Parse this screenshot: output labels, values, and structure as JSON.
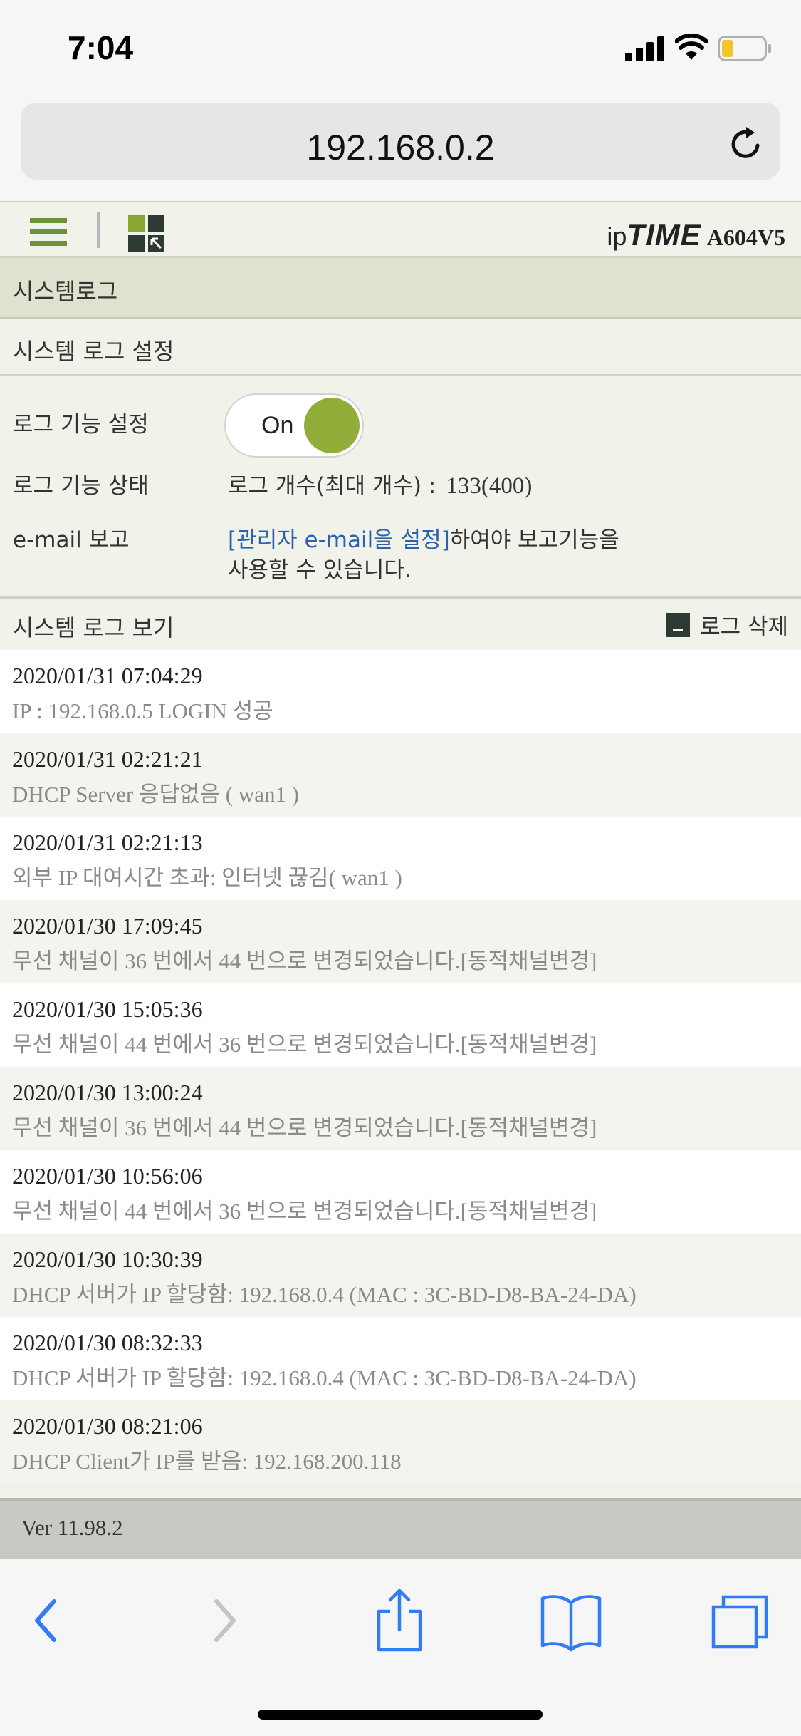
{
  "status_bar": {
    "time": "7:04"
  },
  "browser": {
    "url": "192.168.0.2"
  },
  "router": {
    "brand_ip": "ip",
    "brand_time": "TIME",
    "model": "A604V5",
    "section_title": "시스템로그",
    "settings_header": "시스템 로그 설정",
    "settings": {
      "log_function_label": "로그 기능 설정",
      "toggle_label": "On",
      "log_status_label": "로그 기능 상태",
      "log_count_label": "로그 개수(최대 개수) :",
      "log_count_value": "133(400)",
      "email_label": "e-mail 보고",
      "email_link": "[관리자 e-mail을 설정]",
      "email_text_after_link": "하여야 보고기능을",
      "email_text_line2": "사용할 수 있습니다."
    },
    "log_view_header": "시스템 로그 보기",
    "delete_label": "로그 삭제",
    "logs": [
      {
        "date": "2020/01/31 07:04:29",
        "message": "IP : 192.168.0.5 LOGIN 성공"
      },
      {
        "date": "2020/01/31 02:21:21",
        "message": "DHCP Server 응답없음 ( wan1 )"
      },
      {
        "date": "2020/01/31 02:21:13",
        "message": "외부 IP 대여시간 초과: 인터넷 끊김( wan1 )"
      },
      {
        "date": "2020/01/30 17:09:45",
        "message": "무선 채널이 36 번에서 44 번으로 변경되었습니다.[동적채널변경]"
      },
      {
        "date": "2020/01/30 15:05:36",
        "message": "무선 채널이 44 번에서 36 번으로 변경되었습니다.[동적채널변경]"
      },
      {
        "date": "2020/01/30 13:00:24",
        "message": "무선 채널이 36 번에서 44 번으로 변경되었습니다.[동적채널변경]"
      },
      {
        "date": "2020/01/30 10:56:06",
        "message": "무선 채널이 44 번에서 36 번으로 변경되었습니다.[동적채널변경]"
      },
      {
        "date": "2020/01/30 10:30:39",
        "message": "DHCP 서버가 IP 할당함: 192.168.0.4 (MAC : 3C-BD-D8-BA-24-DA)"
      },
      {
        "date": "2020/01/30 08:32:33",
        "message": "DHCP 서버가 IP 할당함: 192.168.0.4 (MAC : 3C-BD-D8-BA-24-DA)"
      },
      {
        "date": "2020/01/30 08:21:06",
        "message": "DHCP Client가 IP를 받음: 192.168.200.118"
      }
    ],
    "version": "Ver 11.98.2"
  },
  "icons": {
    "status": [
      "signal-icon",
      "wifi-icon",
      "battery-icon"
    ],
    "header": [
      "menu-icon",
      "apps-icon"
    ],
    "toolbar": [
      "back-icon",
      "forward-icon",
      "share-icon",
      "bookmarks-icon",
      "tabs-icon"
    ]
  },
  "colors": {
    "accent_green": "#93ad3b",
    "link_blue": "#2b62b0",
    "ios_blue": "#2f7cf6",
    "section_bg": "#dee3cf"
  }
}
